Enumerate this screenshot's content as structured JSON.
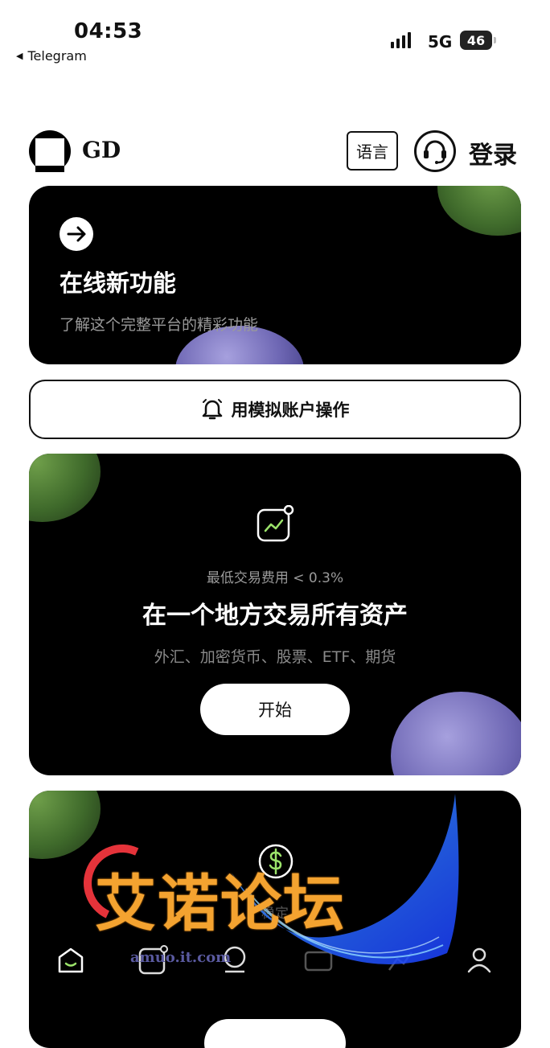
{
  "status_bar": {
    "time": "04:53",
    "back_app": "Telegram",
    "network": "5G",
    "battery": "46"
  },
  "header": {
    "brand": "GD",
    "language_button": "语言",
    "login": "登录"
  },
  "feature_card": {
    "title": "在线新功能",
    "subtitle": "了解这个完整平台的精彩功能"
  },
  "demo_button": {
    "label": "用模拟账户操作"
  },
  "trade_card": {
    "fee_text": "最低交易费用 < 0.3%",
    "title": "在一个地方交易所有资产",
    "assets": "外汇、加密货币、股票、ETF、期货",
    "start_button": "开始"
  },
  "stable_card": {
    "partial_text": "稳定"
  },
  "bottom_nav": {
    "items": [
      "home-icon",
      "chart-icon",
      "trade-icon",
      "wallet-icon",
      "market-icon",
      "profile-icon"
    ]
  },
  "watermark": {
    "text": "艾诺论坛",
    "url": "amuo.it.com"
  },
  "colors": {
    "accent_green": "#4f7d36",
    "accent_purple": "#7a73c0",
    "watermark_orange": "#f4a330"
  }
}
